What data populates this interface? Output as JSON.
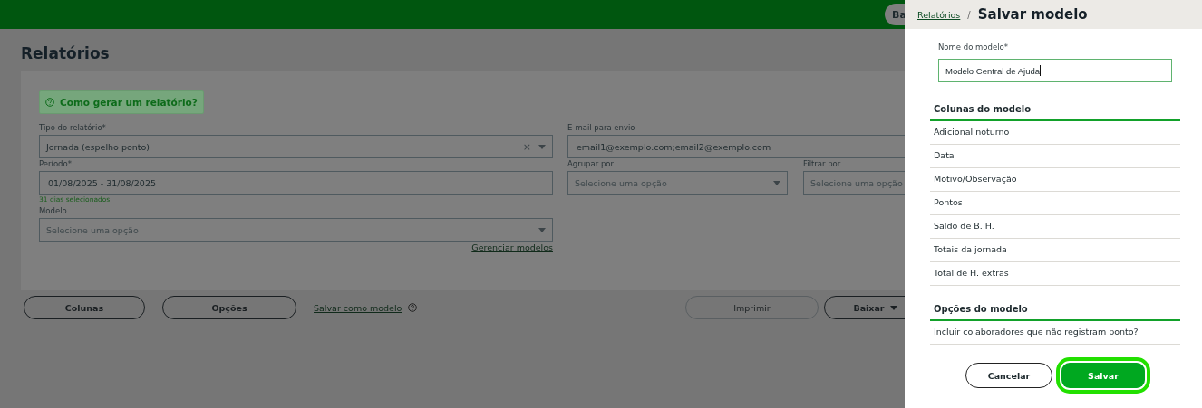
{
  "top_bar": {
    "button_label": "Ba"
  },
  "page": {
    "title": "Relatórios",
    "help_link": "Como gerar um relatório?",
    "left_fields": [
      {
        "kind": "select",
        "label": "Tipo do relatório*",
        "value": "Jornada (espelho ponto)",
        "clear_icon": "×"
      },
      {
        "kind": "text",
        "label": "Período*",
        "value": "01/08/2025 - 31/08/2025",
        "hint": "31 dias selecionados"
      },
      {
        "kind": "select",
        "label": "Modelo",
        "placeholder": "Selecione uma opção",
        "link": "Gerenciar modelos"
      }
    ],
    "right_fields": [
      {
        "kind": "text",
        "label": "E-mail para envio",
        "value": "email1@exemplo.com;email2@exemplo.com"
      }
    ],
    "right_pair": [
      {
        "kind": "select",
        "label": "Agrupar por",
        "placeholder": "Selecione uma opção"
      },
      {
        "kind": "select",
        "label": "Filtrar por",
        "placeholder": "Selecione uma opção"
      }
    ],
    "buttons": [
      {
        "label": "Colunas",
        "disabled": false
      },
      {
        "label": "Opções",
        "disabled": false
      }
    ],
    "save_link": "Salvar como modelo",
    "right_buttons": [
      {
        "label": "Imprimir",
        "disabled": true,
        "menu": false
      },
      {
        "label": "Baixar",
        "disabled": false,
        "menu": true
      }
    ]
  },
  "drawer": {
    "breadcrumb": "Relatórios",
    "separator": "/",
    "title": "Salvar modelo",
    "name_label": "Nome do modelo*",
    "name_value": "Modelo Central de Ajuda",
    "columns_heading": "Colunas do modelo",
    "columns": [
      "Adicional noturno",
      "Data",
      "Motivo/Observação",
      "Pontos",
      "Saldo de B. H.",
      "Totais da jornada",
      "Total de H. extras"
    ],
    "options_heading": "Opções do modelo",
    "options": [
      "Incluir colaboradores que não registram ponto?"
    ],
    "cancel": "Cancelar",
    "save": "Salvar",
    "save_focused": true
  }
}
